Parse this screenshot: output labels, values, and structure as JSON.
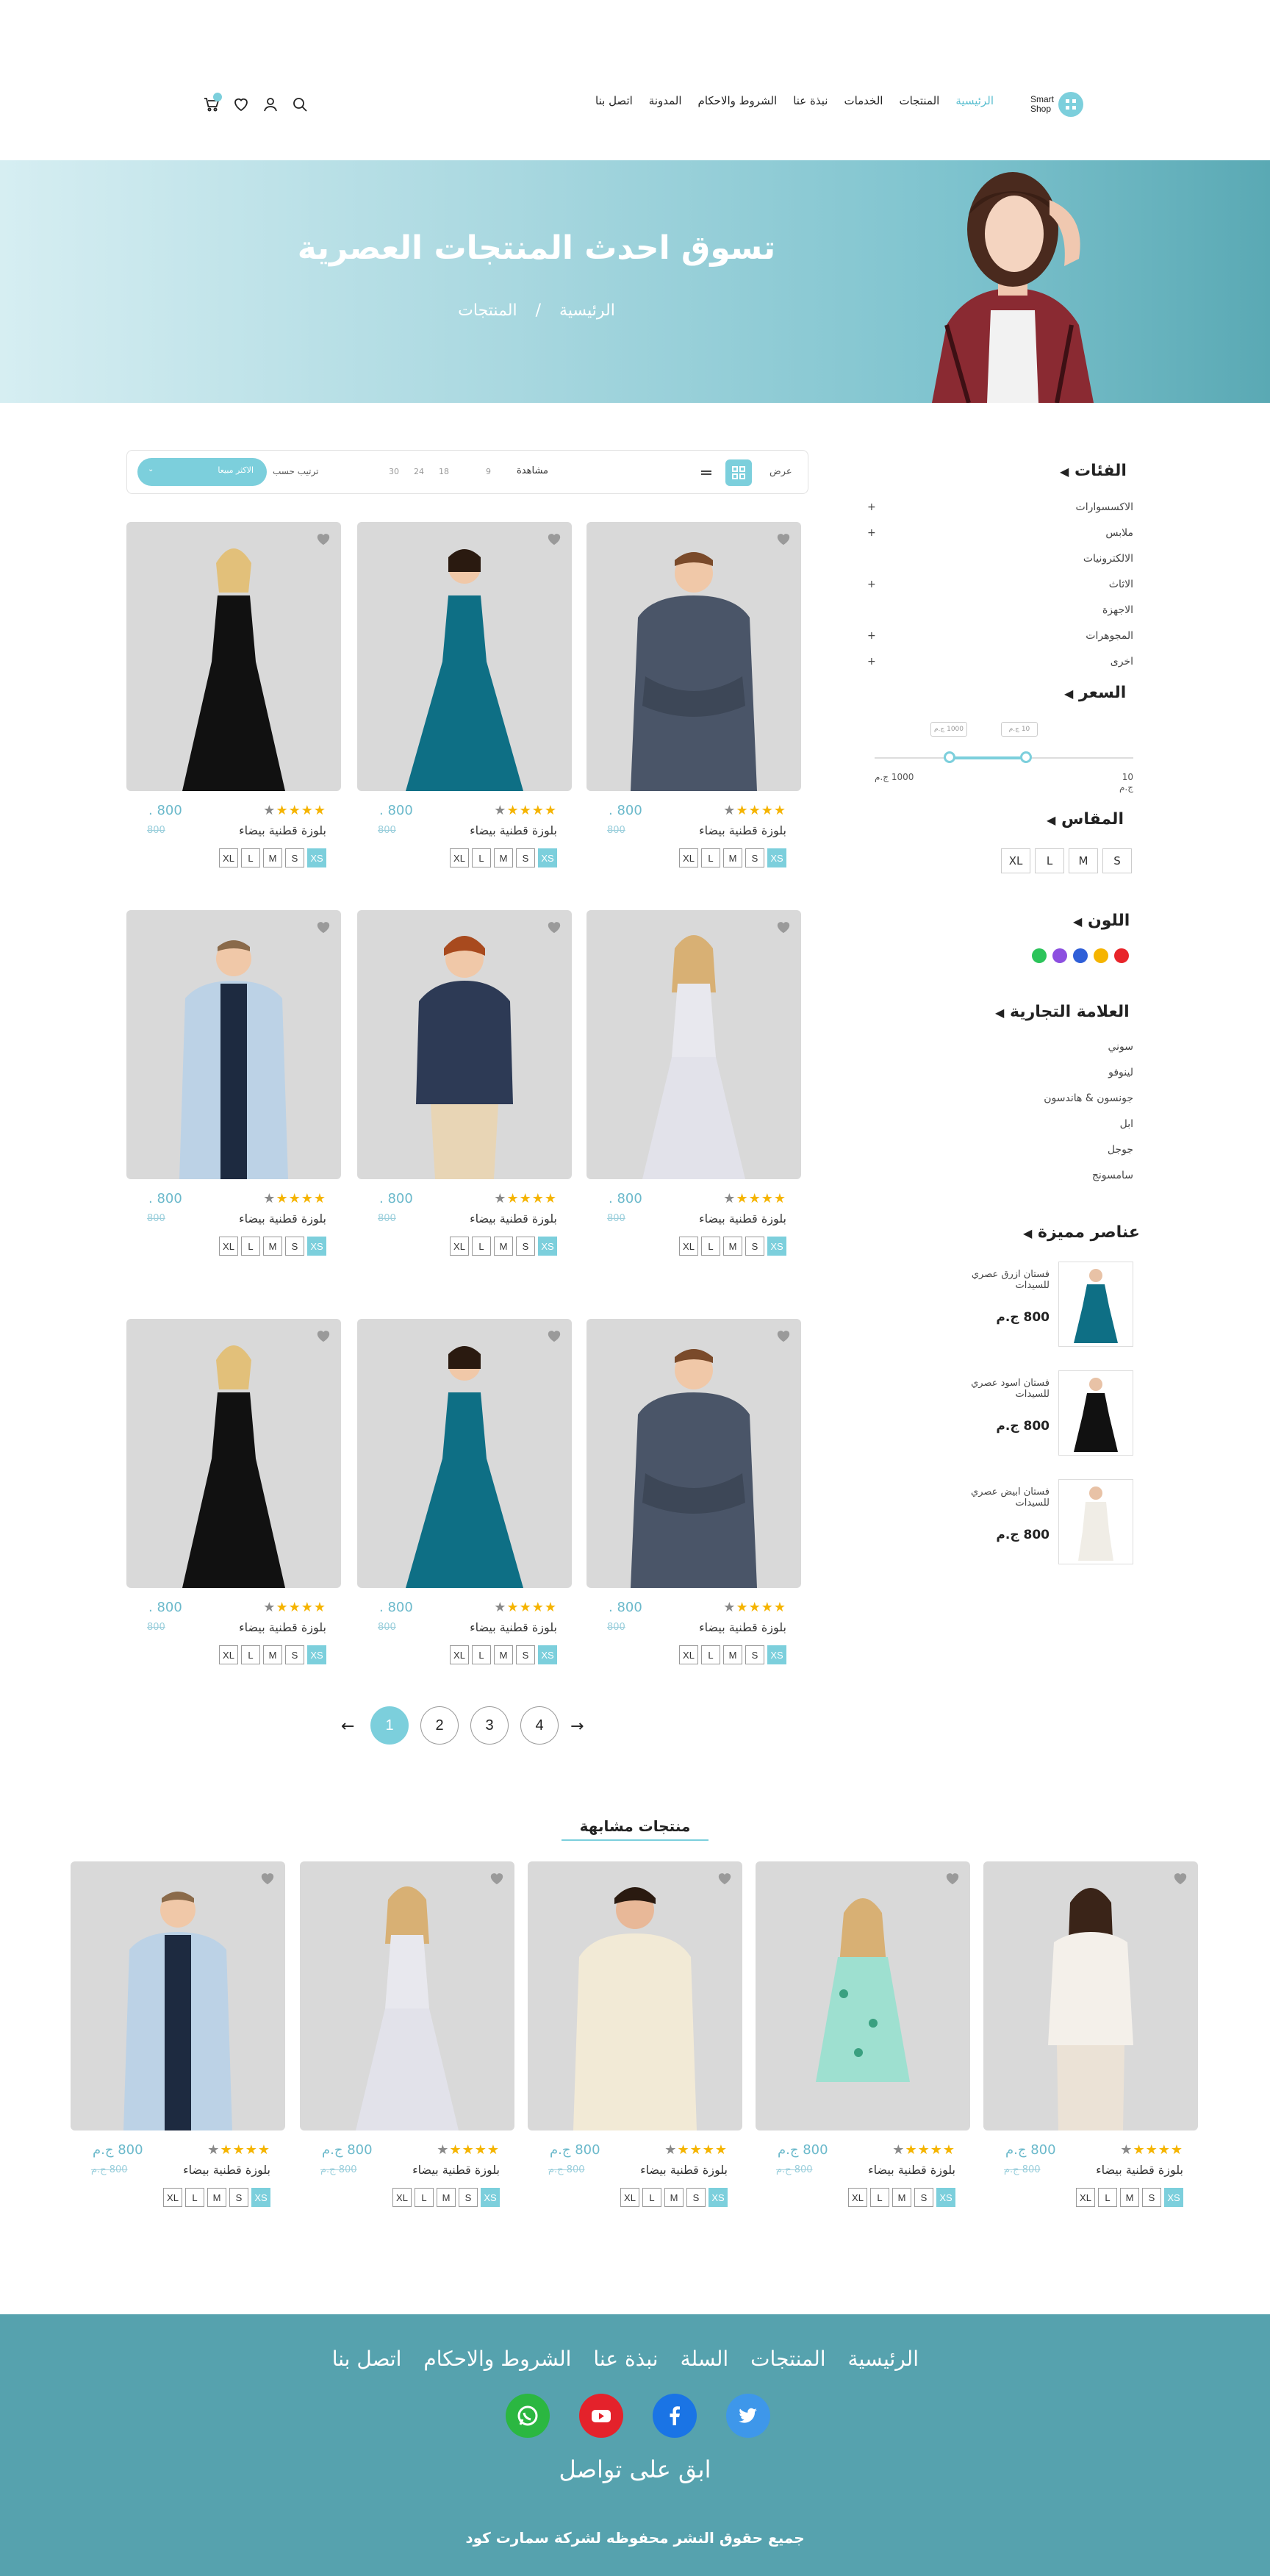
{
  "header": {
    "logo_line1": "Smart",
    "logo_line2": "Shop",
    "nav": [
      "الرئيسية",
      "المنتجات",
      "الخدمات",
      "نبذة عنا",
      "الشروط والاحكام",
      "المدونة",
      "اتصل بنا"
    ],
    "cart_count": "",
    "icons": [
      "search-icon",
      "user-icon",
      "heart-icon",
      "cart-icon"
    ]
  },
  "banner": {
    "title": "تسوق احدث المنتجات العصرية",
    "crumb_home": "الرئيسية",
    "crumb_sep": "/",
    "crumb_current": "المنتجات"
  },
  "sidebar": {
    "categories_title": "الفئات",
    "categories": [
      {
        "label": "الاكسسوارات",
        "expand": "+"
      },
      {
        "label": "ملابس",
        "expand": "+"
      },
      {
        "label": "الالكترونيات",
        "expand": ""
      },
      {
        "label": "الاثاث",
        "expand": "+"
      },
      {
        "label": "الاجهزة",
        "expand": ""
      },
      {
        "label": "المجوهرات",
        "expand": "+"
      },
      {
        "label": "اخرى",
        "expand": "+"
      }
    ],
    "price_title": "السعر",
    "price_min_tag": "10 ج.م",
    "price_max_tag": "1000 ج.م",
    "price_min": "10 ج.م",
    "price_max": "1000 ج.م",
    "size_title": "المقاس",
    "sizes": [
      "S",
      "M",
      "L",
      "XL"
    ],
    "color_title": "اللون",
    "colors": [
      "#e8242a",
      "#f5b400",
      "#2f5fd8",
      "#8c4fe0",
      "#2cc45a"
    ],
    "brand_title": "العلامة التجارية",
    "brands": [
      "سوني",
      "لينوفو",
      "جونسون & هاندسون",
      "ابل",
      "جوجل",
      "سامسونج"
    ],
    "featured_title": "عناصر مميزة",
    "featured": [
      {
        "name": "فستان ازرق عصري للسيدات",
        "price": "800 ج.م"
      },
      {
        "name": "فستان اسود عصري للسيدات",
        "price": "800 ج.م"
      },
      {
        "name": "فستان ابيض عصري للسيدات",
        "price": "800 ج.م"
      }
    ]
  },
  "toolbar": {
    "view_label": "عرض",
    "show_label": "مشاهدة",
    "counts": [
      "9",
      "18",
      "24",
      "30"
    ],
    "sort_label": "ترتيب حسب",
    "sort_value": "الاكثر مبيعا"
  },
  "product": {
    "name": "بلوزة قطنية بيضاء",
    "price": "800",
    "price_currency": ".",
    "old_price": "800",
    "sizes": [
      "XS",
      "S",
      "M",
      "L",
      "XL"
    ],
    "rating": 4
  },
  "pagination": {
    "pages": [
      "1",
      "2",
      "3",
      "4"
    ],
    "active": "1",
    "prev": "←",
    "next": "→"
  },
  "related": {
    "title": "منتجات مشابهة",
    "price": "800 ج.م",
    "old_price": "800 ج.م"
  },
  "footer": {
    "nav": [
      "الرئيسية",
      "المنتجات",
      "السلة",
      "نبذة عنا",
      "الشروط والاحكام",
      "اتصل بنا"
    ],
    "title": "ابق على تواصل",
    "copyright": "جميع حقوق النشر محفوظه لشركة سمارت كود",
    "socials": [
      "twitter-icon",
      "facebook-icon",
      "youtube-icon",
      "whatsapp-icon"
    ]
  }
}
